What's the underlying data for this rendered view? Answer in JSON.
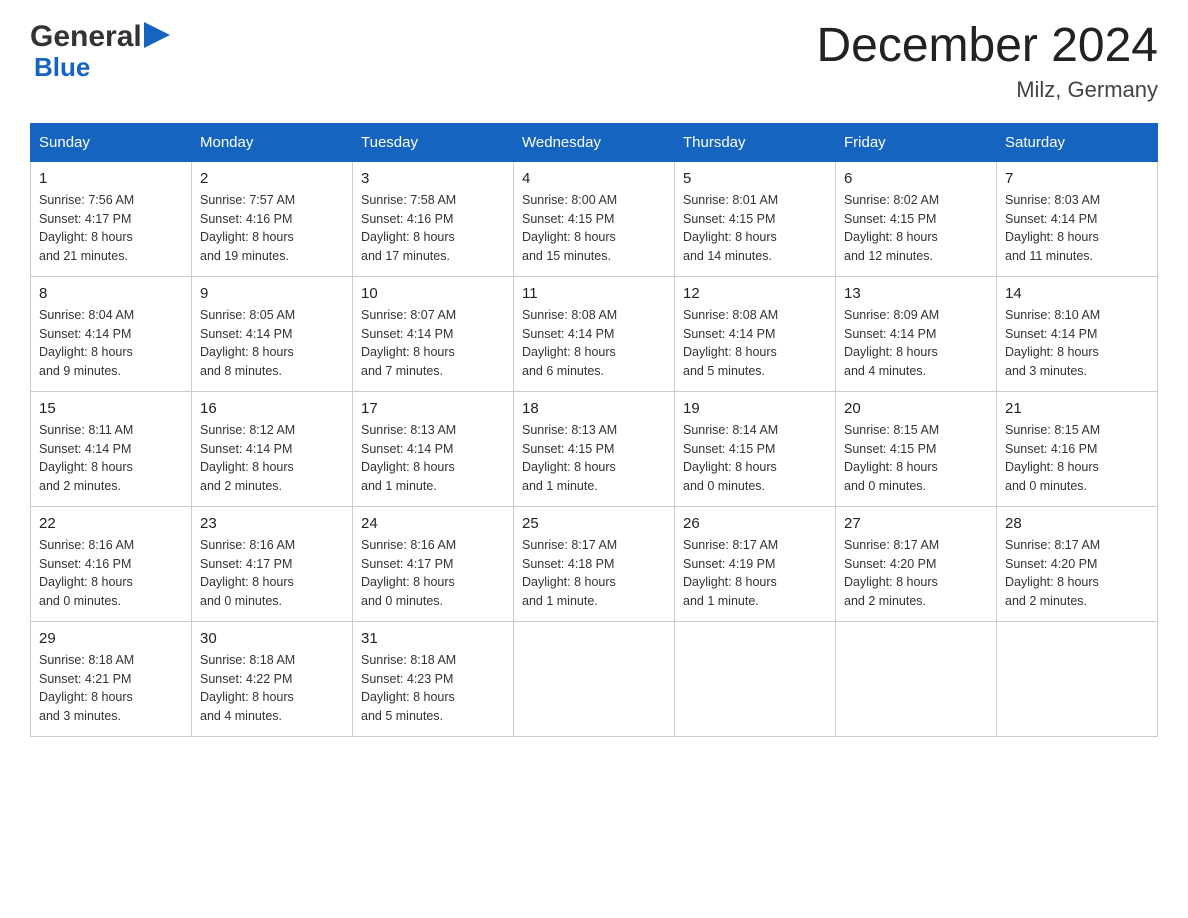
{
  "header": {
    "logo_general": "General",
    "logo_blue": "Blue",
    "month_title": "December 2024",
    "location": "Milz, Germany"
  },
  "days_of_week": [
    "Sunday",
    "Monday",
    "Tuesday",
    "Wednesday",
    "Thursday",
    "Friday",
    "Saturday"
  ],
  "weeks": [
    [
      {
        "day": "1",
        "sunrise": "7:56 AM",
        "sunset": "4:17 PM",
        "daylight": "8 hours and 21 minutes."
      },
      {
        "day": "2",
        "sunrise": "7:57 AM",
        "sunset": "4:16 PM",
        "daylight": "8 hours and 19 minutes."
      },
      {
        "day": "3",
        "sunrise": "7:58 AM",
        "sunset": "4:16 PM",
        "daylight": "8 hours and 17 minutes."
      },
      {
        "day": "4",
        "sunrise": "8:00 AM",
        "sunset": "4:15 PM",
        "daylight": "8 hours and 15 minutes."
      },
      {
        "day": "5",
        "sunrise": "8:01 AM",
        "sunset": "4:15 PM",
        "daylight": "8 hours and 14 minutes."
      },
      {
        "day": "6",
        "sunrise": "8:02 AM",
        "sunset": "4:15 PM",
        "daylight": "8 hours and 12 minutes."
      },
      {
        "day": "7",
        "sunrise": "8:03 AM",
        "sunset": "4:14 PM",
        "daylight": "8 hours and 11 minutes."
      }
    ],
    [
      {
        "day": "8",
        "sunrise": "8:04 AM",
        "sunset": "4:14 PM",
        "daylight": "8 hours and 9 minutes."
      },
      {
        "day": "9",
        "sunrise": "8:05 AM",
        "sunset": "4:14 PM",
        "daylight": "8 hours and 8 minutes."
      },
      {
        "day": "10",
        "sunrise": "8:07 AM",
        "sunset": "4:14 PM",
        "daylight": "8 hours and 7 minutes."
      },
      {
        "day": "11",
        "sunrise": "8:08 AM",
        "sunset": "4:14 PM",
        "daylight": "8 hours and 6 minutes."
      },
      {
        "day": "12",
        "sunrise": "8:08 AM",
        "sunset": "4:14 PM",
        "daylight": "8 hours and 5 minutes."
      },
      {
        "day": "13",
        "sunrise": "8:09 AM",
        "sunset": "4:14 PM",
        "daylight": "8 hours and 4 minutes."
      },
      {
        "day": "14",
        "sunrise": "8:10 AM",
        "sunset": "4:14 PM",
        "daylight": "8 hours and 3 minutes."
      }
    ],
    [
      {
        "day": "15",
        "sunrise": "8:11 AM",
        "sunset": "4:14 PM",
        "daylight": "8 hours and 2 minutes."
      },
      {
        "day": "16",
        "sunrise": "8:12 AM",
        "sunset": "4:14 PM",
        "daylight": "8 hours and 2 minutes."
      },
      {
        "day": "17",
        "sunrise": "8:13 AM",
        "sunset": "4:14 PM",
        "daylight": "8 hours and 1 minute."
      },
      {
        "day": "18",
        "sunrise": "8:13 AM",
        "sunset": "4:15 PM",
        "daylight": "8 hours and 1 minute."
      },
      {
        "day": "19",
        "sunrise": "8:14 AM",
        "sunset": "4:15 PM",
        "daylight": "8 hours and 0 minutes."
      },
      {
        "day": "20",
        "sunrise": "8:15 AM",
        "sunset": "4:15 PM",
        "daylight": "8 hours and 0 minutes."
      },
      {
        "day": "21",
        "sunrise": "8:15 AM",
        "sunset": "4:16 PM",
        "daylight": "8 hours and 0 minutes."
      }
    ],
    [
      {
        "day": "22",
        "sunrise": "8:16 AM",
        "sunset": "4:16 PM",
        "daylight": "8 hours and 0 minutes."
      },
      {
        "day": "23",
        "sunrise": "8:16 AM",
        "sunset": "4:17 PM",
        "daylight": "8 hours and 0 minutes."
      },
      {
        "day": "24",
        "sunrise": "8:16 AM",
        "sunset": "4:17 PM",
        "daylight": "8 hours and 0 minutes."
      },
      {
        "day": "25",
        "sunrise": "8:17 AM",
        "sunset": "4:18 PM",
        "daylight": "8 hours and 1 minute."
      },
      {
        "day": "26",
        "sunrise": "8:17 AM",
        "sunset": "4:19 PM",
        "daylight": "8 hours and 1 minute."
      },
      {
        "day": "27",
        "sunrise": "8:17 AM",
        "sunset": "4:20 PM",
        "daylight": "8 hours and 2 minutes."
      },
      {
        "day": "28",
        "sunrise": "8:17 AM",
        "sunset": "4:20 PM",
        "daylight": "8 hours and 2 minutes."
      }
    ],
    [
      {
        "day": "29",
        "sunrise": "8:18 AM",
        "sunset": "4:21 PM",
        "daylight": "8 hours and 3 minutes."
      },
      {
        "day": "30",
        "sunrise": "8:18 AM",
        "sunset": "4:22 PM",
        "daylight": "8 hours and 4 minutes."
      },
      {
        "day": "31",
        "sunrise": "8:18 AM",
        "sunset": "4:23 PM",
        "daylight": "8 hours and 5 minutes."
      },
      null,
      null,
      null,
      null
    ]
  ],
  "labels": {
    "sunrise": "Sunrise:",
    "sunset": "Sunset:",
    "daylight": "Daylight:"
  }
}
